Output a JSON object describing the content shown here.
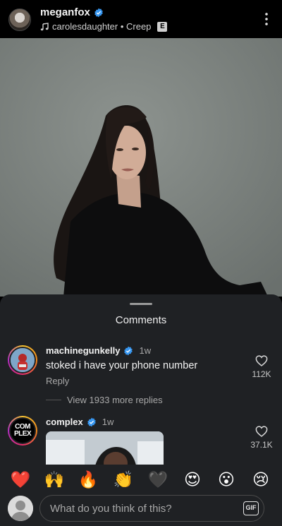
{
  "header": {
    "username": "meganfox",
    "music": "carolesdaughter • Creep",
    "explicit_badge": "E"
  },
  "comments_sheet": {
    "title": "Comments",
    "comments": [
      {
        "username": "machinegunkelly",
        "time": "1w",
        "text": "stoked i have your phone number",
        "reply_label": "Reply",
        "like_count": "112K",
        "view_more": "View 1933 more replies"
      },
      {
        "username": "complex",
        "time": "1w",
        "like_count": "37.1K",
        "avatar_text": "COM PLEX"
      }
    ]
  },
  "emoji_bar": {
    "emojis": [
      "❤️",
      "🙌",
      "🔥",
      "👏",
      "🖤",
      "😍",
      "😮",
      "😢"
    ]
  },
  "composer": {
    "placeholder": "What do you think of this?",
    "gif_label": "GIF"
  },
  "colors": {
    "sheet_bg": "#1f2124",
    "verified_blue": "#3897f0",
    "secondary_text": "#a8a8a8"
  }
}
